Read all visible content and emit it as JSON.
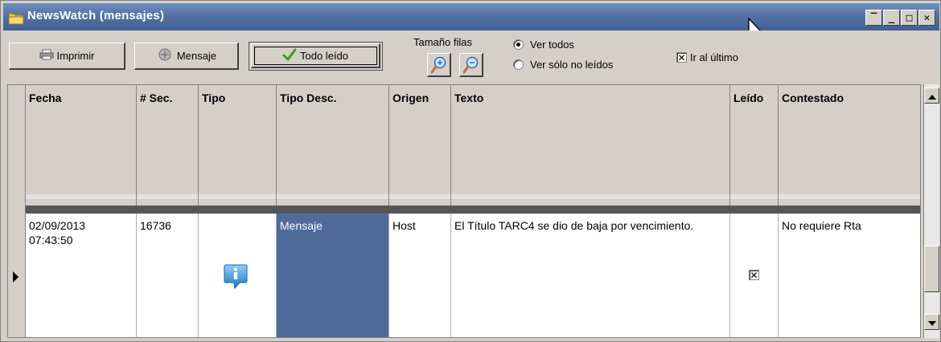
{
  "window": {
    "title": "NewsWatch (mensajes)",
    "controls": [
      {
        "name": "restore-button",
        "glyph": "‾"
      },
      {
        "name": "minimize-button",
        "glyph": "_"
      },
      {
        "name": "maximize-button",
        "glyph": "□"
      },
      {
        "name": "close-button",
        "glyph": "✕"
      }
    ]
  },
  "toolbar": {
    "print_label": "Imprimir",
    "message_label": "Mensaje",
    "mark_all_read_label": "Todo leído",
    "row_size_label": "Tamaño filas",
    "view_all_label": "Ver todos",
    "view_unread_label": "Ver sólo no leídos",
    "view_all_checked": true,
    "view_unread_checked": false,
    "go_last_label": "Ir al último",
    "go_last_checked": true
  },
  "grid": {
    "columns": [
      "Fecha",
      "# Sec.",
      "Tipo",
      "Tipo Desc.",
      "Origen",
      "Texto",
      "Leído",
      "Contestado"
    ],
    "rows": [
      {
        "fecha": "02/09/2013",
        "hora": "07:43:50",
        "sec": "16736",
        "tipo_icon": "info-icon",
        "tipo_desc": "Mensaje",
        "origen": "Host",
        "texto": "El Título  TARC4 se dio de baja por vencimiento.",
        "leido": true,
        "contestado": "No requiere Rta"
      }
    ]
  },
  "colors": {
    "title_bar": "#5572a3",
    "window_bg": "#d4d0c8",
    "selected_cell": "#4f6b9a",
    "check_green": "#3a9a1e",
    "info_blue": "#2a86d8"
  }
}
